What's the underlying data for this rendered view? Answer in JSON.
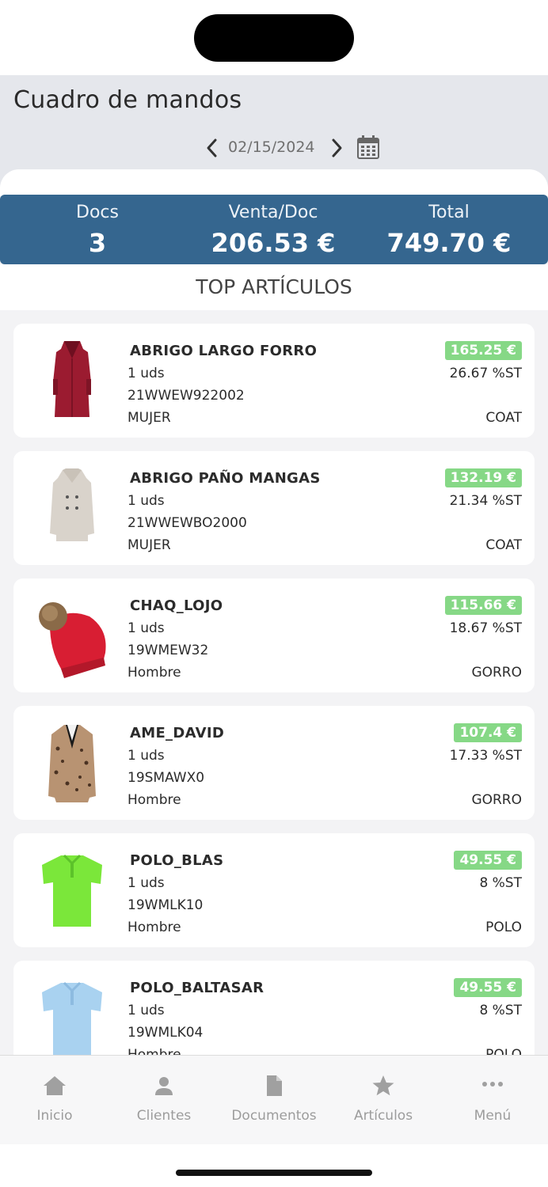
{
  "header": {
    "title": "Cuadro de mandos",
    "date": "02/15/2024",
    "prev_icon": "chevron-left-icon",
    "next_icon": "chevron-right-icon",
    "calendar_icon": "calendar-icon"
  },
  "stats": {
    "docs_label": "Docs",
    "docs_value": "3",
    "avg_label": "Venta/Doc",
    "avg_value": "206.53 €",
    "total_label": "Total",
    "total_value": "749.70 €",
    "accent": "#35668f"
  },
  "section_title": "TOP ARTÍCULOS",
  "items": [
    {
      "name": "ABRIGO LARGO FORRO",
      "units": "1 uds",
      "code": "21WWEW922002",
      "gender": "MUJER",
      "price": "165.25 €",
      "pct": "26.67 %ST",
      "category": "COAT",
      "image": "red-coat-image"
    },
    {
      "name": "ABRIGO PAÑO MANGAS",
      "units": "1 uds",
      "code": "21WWEWBO2000",
      "gender": "MUJER",
      "price": "132.19 €",
      "pct": "21.34 %ST",
      "category": "COAT",
      "image": "beige-coat-image"
    },
    {
      "name": "CHAQ_LOJO",
      "units": "1 uds",
      "code": "19WMEW32",
      "gender": "Hombre",
      "price": "115.66 €",
      "pct": "18.67 %ST",
      "category": "GORRO",
      "image": "red-beanie-image"
    },
    {
      "name": "AME_DAVID",
      "units": "1 uds",
      "code": "19SMAWX0",
      "gender": "Hombre",
      "price": "107.4 €",
      "pct": "17.33 %ST",
      "category": "GORRO",
      "image": "leopard-blazer-image"
    },
    {
      "name": "POLO_BLAS",
      "units": "1 uds",
      "code": "19WMLK10",
      "gender": "Hombre",
      "price": "49.55 €",
      "pct": "8 %ST",
      "category": "POLO",
      "image": "green-polo-image"
    },
    {
      "name": "POLO_BALTASAR",
      "units": "1 uds",
      "code": "19WMLK04",
      "gender": "Hombre",
      "price": "49.55 €",
      "pct": "8 %ST",
      "category": "POLO",
      "image": "blue-polo-image"
    }
  ],
  "tabs": [
    {
      "label": "Inicio",
      "icon": "home-icon"
    },
    {
      "label": "Clientes",
      "icon": "user-icon"
    },
    {
      "label": "Documentos",
      "icon": "document-icon"
    },
    {
      "label": "Artículos",
      "icon": "star-icon"
    },
    {
      "label": "Menú",
      "icon": "more-icon"
    }
  ],
  "colors": {
    "price_badge": "#86d886",
    "background": "#e5e7ec",
    "tab_inactive": "#9c9c9c"
  }
}
